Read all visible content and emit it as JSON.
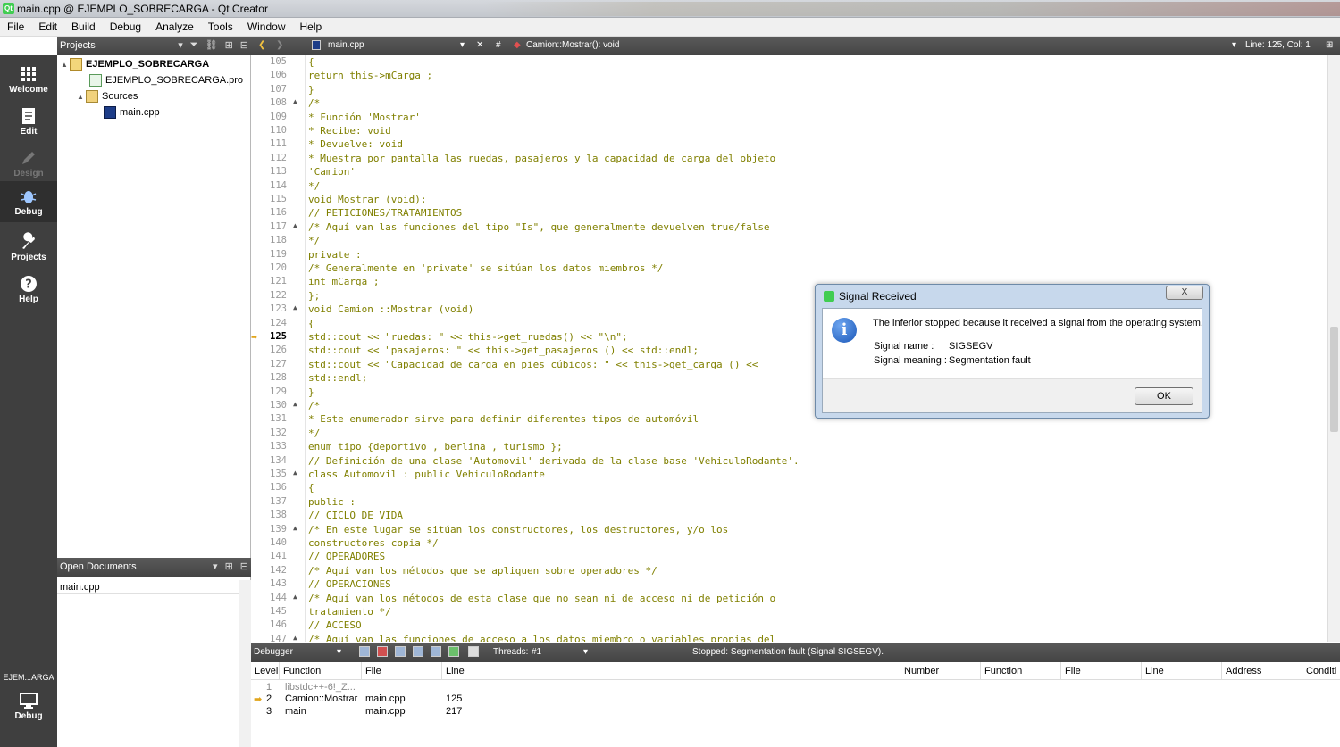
{
  "window": {
    "title": "main.cpp @ EJEMPLO_SOBRECARGA - Qt Creator"
  },
  "menu": [
    "File",
    "Edit",
    "Build",
    "Debug",
    "Analyze",
    "Tools",
    "Window",
    "Help"
  ],
  "modes": [
    {
      "label": "Welcome",
      "icon": "grid-icon"
    },
    {
      "label": "Edit",
      "icon": "document-icon"
    },
    {
      "label": "Design",
      "icon": "pencil-icon"
    },
    {
      "label": "Debug",
      "icon": "bug-icon"
    },
    {
      "label": "Projects",
      "icon": "wrench-icon"
    },
    {
      "label": "Help",
      "icon": "question-icon"
    }
  ],
  "kit": {
    "name": "EJEM...ARGA",
    "mode": "Debug"
  },
  "projects_pane": {
    "title": "Projects",
    "tree": [
      {
        "label": "EJEMPLO_SOBRECARGA",
        "level": 0,
        "type": "project"
      },
      {
        "label": "EJEMPLO_SOBRECARGA.pro",
        "level": 1,
        "type": "pro"
      },
      {
        "label": "Sources",
        "level": 1,
        "type": "folder"
      },
      {
        "label": "main.cpp",
        "level": 2,
        "type": "cpp"
      }
    ]
  },
  "open_documents": {
    "title": "Open Documents",
    "items": [
      "main.cpp"
    ]
  },
  "editor_toolbar": {
    "file": "main.cpp",
    "hash": "#",
    "symbol": "Camion::Mostrar(): void",
    "position": "Line: 125, Col: 1"
  },
  "code": [
    {
      "n": "105",
      "t": "{"
    },
    {
      "n": "106",
      "t": "return this->mCarga ;"
    },
    {
      "n": "107",
      "t": "}"
    },
    {
      "n": "108",
      "t": "/*",
      "fold": true
    },
    {
      "n": "109",
      "t": "* Función 'Mostrar'"
    },
    {
      "n": "110",
      "t": "* Recibe: void"
    },
    {
      "n": "111",
      "t": "* Devuelve: void"
    },
    {
      "n": "112",
      "t": "* Muestra por pantalla las ruedas, pasajeros y la capacidad de carga del objeto"
    },
    {
      "n": "113",
      "t": "'Camion'"
    },
    {
      "n": "114",
      "t": "*/"
    },
    {
      "n": "115",
      "t": "void Mostrar (void);"
    },
    {
      "n": "116",
      "t": "// PETICIONES/TRATAMIENTOS"
    },
    {
      "n": "117",
      "t": "/* Aquí van las funciones del tipo \"Is\", que generalmente devuelven true/false",
      "fold": true
    },
    {
      "n": "118",
      "t": "*/"
    },
    {
      "n": "119",
      "t": "private :"
    },
    {
      "n": "120",
      "t": "/* Generalmente en 'private' se sitúan los datos miembros */"
    },
    {
      "n": "121",
      "t": "int mCarga ;"
    },
    {
      "n": "122",
      "t": "};"
    },
    {
      "n": "123",
      "t": "void Camion ::Mostrar (void)",
      "fold": true
    },
    {
      "n": "124",
      "t": "{"
    },
    {
      "n": "125",
      "t": "std::cout << \"ruedas: \" << this->get_ruedas() << \"\\n\";",
      "current": true
    },
    {
      "n": "126",
      "t": "std::cout << \"pasajeros: \" << this->get_pasajeros () << std::endl;"
    },
    {
      "n": "127",
      "t": "std::cout << \"Capacidad de carga en pies cúbicos: \" << this->get_carga () <<"
    },
    {
      "n": "128",
      "t": "std::endl;"
    },
    {
      "n": "129",
      "t": "}"
    },
    {
      "n": "130",
      "t": "/*",
      "fold": true
    },
    {
      "n": "131",
      "t": "* Este enumerador sirve para definir diferentes tipos de automóvil"
    },
    {
      "n": "132",
      "t": "*/"
    },
    {
      "n": "133",
      "t": "enum tipo {deportivo , berlina , turismo };"
    },
    {
      "n": "134",
      "t": "// Definición de una clase 'Automovil' derivada de la clase base 'VehiculoRodante'."
    },
    {
      "n": "135",
      "t": "class Automovil : public VehiculoRodante",
      "fold": true
    },
    {
      "n": "136",
      "t": "{"
    },
    {
      "n": "137",
      "t": "public :"
    },
    {
      "n": "138",
      "t": "// CICLO DE VIDA"
    },
    {
      "n": "139",
      "t": "/* En este lugar se sitúan los constructores, los destructores, y/o los",
      "fold": true
    },
    {
      "n": "140",
      "t": "constructores copia */"
    },
    {
      "n": "141",
      "t": "// OPERADORES"
    },
    {
      "n": "142",
      "t": "/* Aquí van los métodos que se apliquen sobre operadores */"
    },
    {
      "n": "143",
      "t": "// OPERACIONES"
    },
    {
      "n": "144",
      "t": "/* Aquí van los métodos de esta clase que no sean ni de acceso ni de petición o",
      "fold": true
    },
    {
      "n": "145",
      "t": "tratamiento */"
    },
    {
      "n": "146",
      "t": "// ACCESO"
    },
    {
      "n": "147",
      "t": "/* Aquí van las funciones de acceso a los datos miembro o variables propias del",
      "fold": true
    }
  ],
  "debugger_toolbar": {
    "title": "Debugger",
    "threads_label": "Threads:",
    "thread": "#1",
    "status": "Stopped: Segmentation fault (Signal SIGSEGV)."
  },
  "stack": {
    "columns": [
      "Level",
      "Function",
      "File",
      "Line"
    ],
    "rows": [
      {
        "level": "1",
        "function": "libstdc++-6!_Z...",
        "file": "",
        "line": ""
      },
      {
        "level": "2",
        "function": "Camion::Mostrar",
        "file": "main.cpp",
        "line": "125",
        "current": true
      },
      {
        "level": "3",
        "function": "main",
        "file": "main.cpp",
        "line": "217"
      }
    ]
  },
  "breakpoints": {
    "columns": [
      "Number",
      "Function",
      "File",
      "Line",
      "Address",
      "Conditi"
    ]
  },
  "dialog": {
    "title": "Signal Received",
    "message": "The inferior stopped because it received a signal from the operating system.",
    "name_label": "Signal name :",
    "name_value": "SIGSEGV",
    "meaning_label": "Signal meaning :",
    "meaning_value": "Segmentation fault",
    "ok": "OK",
    "close": "X"
  }
}
